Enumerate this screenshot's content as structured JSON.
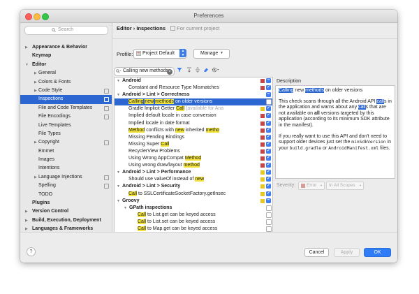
{
  "window": {
    "title": "Preferences"
  },
  "sidebar": {
    "search_placeholder": "Search",
    "items": [
      {
        "label": "Appearance & Behavior",
        "bold": true,
        "arrow": "▶",
        "indent": 0,
        "page": false
      },
      {
        "label": "Keymap",
        "bold": true,
        "arrow": "",
        "indent": 0,
        "page": false
      },
      {
        "label": "Editor",
        "bold": true,
        "arrow": "▼",
        "indent": 0,
        "page": false
      },
      {
        "label": "General",
        "bold": false,
        "arrow": "▶",
        "indent": 1,
        "page": false
      },
      {
        "label": "Colors & Fonts",
        "bold": false,
        "arrow": "▶",
        "indent": 1,
        "page": false
      },
      {
        "label": "Code Style",
        "bold": false,
        "arrow": "▶",
        "indent": 1,
        "page": true
      },
      {
        "label": "Inspections",
        "bold": false,
        "arrow": "",
        "indent": 1,
        "page": true,
        "selected": true
      },
      {
        "label": "File and Code Templates",
        "bold": false,
        "arrow": "",
        "indent": 1,
        "page": true
      },
      {
        "label": "File Encodings",
        "bold": false,
        "arrow": "",
        "indent": 1,
        "page": true
      },
      {
        "label": "Live Templates",
        "bold": false,
        "arrow": "",
        "indent": 1,
        "page": false
      },
      {
        "label": "File Types",
        "bold": false,
        "arrow": "",
        "indent": 1,
        "page": false
      },
      {
        "label": "Copyright",
        "bold": false,
        "arrow": "▶",
        "indent": 1,
        "page": true
      },
      {
        "label": "Emmet",
        "bold": false,
        "arrow": "",
        "indent": 1,
        "page": false
      },
      {
        "label": "Images",
        "bold": false,
        "arrow": "",
        "indent": 1,
        "page": false
      },
      {
        "label": "Intentions",
        "bold": false,
        "arrow": "",
        "indent": 1,
        "page": false
      },
      {
        "label": "Language Injections",
        "bold": false,
        "arrow": "▶",
        "indent": 1,
        "page": true
      },
      {
        "label": "Spelling",
        "bold": false,
        "arrow": "",
        "indent": 1,
        "page": true
      },
      {
        "label": "TODO",
        "bold": false,
        "arrow": "",
        "indent": 1,
        "page": false
      },
      {
        "label": "Plugins",
        "bold": true,
        "arrow": "",
        "indent": 0,
        "page": false
      },
      {
        "label": "Version Control",
        "bold": true,
        "arrow": "▶",
        "indent": 0,
        "page": false
      },
      {
        "label": "Build, Execution, Deployment",
        "bold": true,
        "arrow": "▶",
        "indent": 0,
        "page": false
      },
      {
        "label": "Languages & Frameworks",
        "bold": true,
        "arrow": "▶",
        "indent": 0,
        "page": false
      },
      {
        "label": "Tools",
        "bold": true,
        "arrow": "▶",
        "indent": 0,
        "page": false
      }
    ]
  },
  "header": {
    "breadcrumb_parent": "Editor",
    "breadcrumb_sep": " › ",
    "breadcrumb_current": "Inspections",
    "scope_note": "For current project"
  },
  "profile": {
    "label": "Profile:",
    "value": "Project Default",
    "manage_label": "Manage"
  },
  "filter": {
    "value": "Calling new methods"
  },
  "inspections": [
    {
      "indent": 0,
      "arrow": "▼",
      "bold": true,
      "parts": [
        [
          "Android",
          ""
        ]
      ],
      "sev": "red",
      "chk": "mixed"
    },
    {
      "indent": 1,
      "arrow": "",
      "bold": false,
      "parts": [
        [
          "Constant and Resource Type Mismatches",
          ""
        ]
      ],
      "sev": "red",
      "chk": "on"
    },
    {
      "indent": 0,
      "arrow": "▼",
      "bold": true,
      "parts": [
        [
          "Android > Lint > Correctness",
          ""
        ]
      ],
      "sev": "",
      "chk": "mixed"
    },
    {
      "indent": 1,
      "arrow": "",
      "bold": false,
      "selected": true,
      "parts": [
        [
          "Calling",
          "hl"
        ],
        [
          " ",
          ""
        ],
        [
          "new",
          "hl"
        ],
        [
          " ",
          ""
        ],
        [
          "methods",
          "hl"
        ],
        [
          " on older versions",
          ""
        ]
      ],
      "sev": "",
      "chk": "off"
    },
    {
      "indent": 1,
      "arrow": "",
      "bold": false,
      "parts": [
        [
          "Gradle Implicit Getter ",
          ""
        ],
        [
          "Call",
          "hl"
        ],
        [
          " (available for Ana",
          "dim"
        ]
      ],
      "sev": "yellow",
      "chk": "on"
    },
    {
      "indent": 1,
      "arrow": "",
      "bold": false,
      "parts": [
        [
          "Implied default locale in case conversion",
          ""
        ]
      ],
      "sev": "red",
      "chk": "on"
    },
    {
      "indent": 1,
      "arrow": "",
      "bold": false,
      "parts": [
        [
          "Implied locale in date format",
          ""
        ]
      ],
      "sev": "red",
      "chk": "on"
    },
    {
      "indent": 1,
      "arrow": "",
      "bold": false,
      "parts": [
        [
          "Method",
          "hl"
        ],
        [
          " conflicts with ",
          ""
        ],
        [
          "new",
          "hl"
        ],
        [
          " inherited ",
          ""
        ],
        [
          "metho",
          "hl"
        ]
      ],
      "sev": "red",
      "chk": "on"
    },
    {
      "indent": 1,
      "arrow": "",
      "bold": false,
      "parts": [
        [
          "Missing Pending Bindings",
          ""
        ]
      ],
      "sev": "red",
      "chk": "on"
    },
    {
      "indent": 1,
      "arrow": "",
      "bold": false,
      "parts": [
        [
          "Missing Super ",
          ""
        ],
        [
          "Call",
          "hl"
        ]
      ],
      "sev": "red",
      "chk": "on"
    },
    {
      "indent": 1,
      "arrow": "",
      "bold": false,
      "parts": [
        [
          "RecyclerView Problems",
          ""
        ]
      ],
      "sev": "red",
      "chk": "on"
    },
    {
      "indent": 1,
      "arrow": "",
      "bold": false,
      "parts": [
        [
          "Using Wrong AppCompat ",
          ""
        ],
        [
          "Method",
          "hl"
        ]
      ],
      "sev": "red",
      "chk": "on"
    },
    {
      "indent": 1,
      "arrow": "",
      "bold": false,
      "parts": [
        [
          "Using wrong draw/layout ",
          ""
        ],
        [
          "method",
          "hl"
        ]
      ],
      "sev": "red",
      "chk": "on"
    },
    {
      "indent": 0,
      "arrow": "▼",
      "bold": true,
      "parts": [
        [
          "Android > Lint > Performance",
          ""
        ]
      ],
      "sev": "yellow",
      "chk": "on"
    },
    {
      "indent": 1,
      "arrow": "",
      "bold": false,
      "parts": [
        [
          "Should use valueOf instead of ",
          ""
        ],
        [
          "new",
          "hl"
        ]
      ],
      "sev": "yellow",
      "chk": "on"
    },
    {
      "indent": 0,
      "arrow": "▼",
      "bold": true,
      "parts": [
        [
          "Android > Lint > Security",
          ""
        ]
      ],
      "sev": "yellow",
      "chk": "on"
    },
    {
      "indent": 1,
      "arrow": "",
      "bold": false,
      "parts": [
        [
          "Call",
          "hl"
        ],
        [
          " to SSLCertificateSocketFactory.getInsec",
          ""
        ]
      ],
      "sev": "yellow",
      "chk": "on"
    },
    {
      "indent": 0,
      "arrow": "▼",
      "bold": true,
      "parts": [
        [
          "Groovy",
          ""
        ]
      ],
      "sev": "yellow",
      "chk": "mixed"
    },
    {
      "indent": 1,
      "arrow": "▼",
      "bold": true,
      "parts": [
        [
          "GPath inspections",
          ""
        ]
      ],
      "sev": "",
      "chk": "off"
    },
    {
      "indent": 2,
      "arrow": "",
      "bold": false,
      "parts": [
        [
          "Call",
          "hl"
        ],
        [
          " to List.get can be keyed access",
          ""
        ]
      ],
      "sev": "",
      "chk": "off"
    },
    {
      "indent": 2,
      "arrow": "",
      "bold": false,
      "parts": [
        [
          "Call",
          "hl"
        ],
        [
          " to List.set can be keyed access",
          ""
        ]
      ],
      "sev": "",
      "chk": "off"
    },
    {
      "indent": 2,
      "arrow": "",
      "bold": false,
      "parts": [
        [
          "Call",
          "hl"
        ],
        [
          " to Map.get can be keyed access",
          ""
        ]
      ],
      "sev": "",
      "chk": "off"
    },
    {
      "indent": 2,
      "arrow": "",
      "bold": false,
      "parts": [
        [
          "Call",
          "hl"
        ],
        [
          " to Map.put can be keyed access",
          ""
        ]
      ],
      "sev": "",
      "chk": "off"
    },
    {
      "indent": 1,
      "arrow": "▼",
      "bold": true,
      "parts": [
        [
          "Probable bugs",
          ""
        ]
      ],
      "sev": "yellow",
      "chk": "on"
    }
  ],
  "description": {
    "label": "Description",
    "p1": [
      [
        "Calling",
        "sh"
      ],
      [
        " new ",
        ""
      ],
      [
        "methods",
        "sh"
      ],
      [
        " on older versions",
        ""
      ]
    ],
    "p2": [
      [
        "This check scans through all the Android API ",
        ""
      ],
      [
        "call",
        "sh"
      ],
      [
        "s in the application and warns about any ",
        ""
      ],
      [
        "call",
        "sh"
      ],
      [
        "s that are not available on ",
        ""
      ],
      [
        "all",
        "b"
      ],
      [
        " versions targeted by this application (according to its minimum SDK attribute in the manifest).",
        ""
      ]
    ],
    "p3": [
      [
        "If you really want to use this API and don't need to support older devices just set the ",
        ""
      ],
      [
        "minSdkVersion",
        "mono"
      ],
      [
        " in your ",
        ""
      ],
      [
        "build.gradle",
        "mono"
      ],
      [
        " or ",
        ""
      ],
      [
        "AndroidManifest.xml",
        "mono"
      ],
      [
        " files.",
        ""
      ]
    ]
  },
  "severity": {
    "label": "Severity:",
    "value": "Error",
    "scope": "In All Scopes"
  },
  "footer": {
    "help": "?",
    "cancel": "Cancel",
    "apply": "Apply",
    "ok": "OK"
  },
  "colors": {
    "selection": "#2b66d1",
    "highlight": "#f2e33a",
    "checkbox": "#3e7ef2",
    "severity_error": "#c74545",
    "severity_warning": "#e8c81e",
    "ok_button": "#2f7cf6"
  }
}
